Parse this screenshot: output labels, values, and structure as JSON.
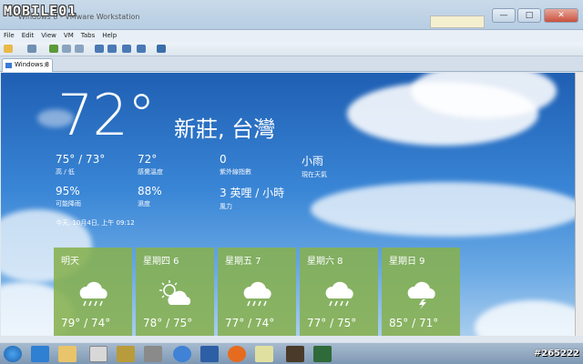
{
  "window": {
    "logo": "MOBILE01",
    "title": "Windows 8 - VMware Workstation",
    "minimize": "—",
    "maximize": "□",
    "close": "✕"
  },
  "menu": [
    "File",
    "Edit",
    "View",
    "VM",
    "Tabs",
    "Help"
  ],
  "tab": {
    "label": "Windows 8",
    "close": "×"
  },
  "weather": {
    "current_temp": "72°",
    "location": "新莊, 台灣",
    "stats": [
      {
        "value": "75° / 73°",
        "label": "高 / 低"
      },
      {
        "value": "72°",
        "label": "感覺溫度"
      },
      {
        "value": "0",
        "label": "紫外線指數"
      },
      {
        "value": "小雨",
        "label": "現在天氣"
      },
      {
        "value": "95%",
        "label": "可能降雨"
      },
      {
        "value": "88%",
        "label": "濕度"
      },
      {
        "value": "3 英哩 / 小時",
        "label": "風力"
      }
    ],
    "timestamp": "今天, 10月4日, 上午 09:12",
    "forecast": [
      {
        "day": "明天",
        "hilo": "79° / 74°",
        "icon": "rain-icon"
      },
      {
        "day": "星期四 6",
        "hilo": "78° / 75°",
        "icon": "partly-sunny-icon"
      },
      {
        "day": "星期五 7",
        "hilo": "77° / 74°",
        "icon": "rain-icon"
      },
      {
        "day": "星期六 8",
        "hilo": "77° / 75°",
        "icon": "rain-icon"
      },
      {
        "day": "星期日 9",
        "hilo": "85° / 71°",
        "icon": "thunderstorm-icon"
      }
    ],
    "tile_color": "#86b04e"
  },
  "watermark": "#265222",
  "colors": {
    "sky_top": "#1f5fb3",
    "sky_bottom": "#a9cdef"
  }
}
